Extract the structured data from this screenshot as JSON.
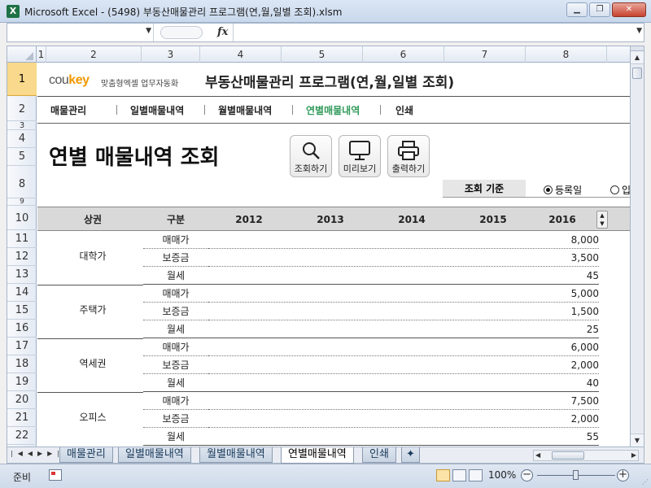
{
  "window": {
    "title": "Microsoft Excel - (5498) 부동산매물관리 프로그램(연,월,일별 조회).xlsm",
    "app_icon": "X",
    "minimize": "▁",
    "restore": "❐",
    "close": "✕"
  },
  "formula_bar": {
    "fx": "fx"
  },
  "columns": [
    "1",
    "2",
    "3",
    "4",
    "5",
    "6",
    "7",
    "8"
  ],
  "rows": [
    "1",
    "2",
    "3",
    "4",
    "5",
    "8",
    "9",
    "10",
    "11",
    "12",
    "13",
    "14",
    "15",
    "16",
    "17",
    "18",
    "19",
    "20",
    "21",
    "22"
  ],
  "header": {
    "logo_brand_prefix": "cou",
    "logo_brand_key": "key",
    "logo_sub": "맞춤형엑셀 업무자동화",
    "title": "부동산매물관리 프로그램(연,월,일별 조회)"
  },
  "nav": [
    "매물관리",
    "일별매물내역",
    "월별매물내역",
    "연별매물내역",
    "인쇄"
  ],
  "page": {
    "title": "연별 매물내역 조회",
    "buttons": {
      "search": "조회하기",
      "preview": "미리보기",
      "print": "출력하기"
    }
  },
  "criteria": {
    "label": "조회 기준",
    "option_selected": "등록일",
    "option_other": "입"
  },
  "table": {
    "headers": [
      "상권",
      "구분",
      "2012",
      "2013",
      "2014",
      "2015",
      "2016"
    ],
    "groups": [
      {
        "region": "대학가",
        "rows": [
          {
            "type": "매매가",
            "value": "8,000"
          },
          {
            "type": "보증금",
            "value": "3,500"
          },
          {
            "type": "월세",
            "value": "45"
          }
        ]
      },
      {
        "region": "주택가",
        "rows": [
          {
            "type": "매매가",
            "value": "5,000"
          },
          {
            "type": "보증금",
            "value": "1,500"
          },
          {
            "type": "월세",
            "value": "25"
          }
        ]
      },
      {
        "region": "역세권",
        "rows": [
          {
            "type": "매매가",
            "value": "6,000"
          },
          {
            "type": "보증금",
            "value": "2,000"
          },
          {
            "type": "월세",
            "value": "40"
          }
        ]
      },
      {
        "region": "오피스",
        "rows": [
          {
            "type": "매매가",
            "value": "7,500"
          },
          {
            "type": "보증금",
            "value": "2,000"
          },
          {
            "type": "월세",
            "value": "55"
          }
        ]
      }
    ]
  },
  "sheet_tabs": [
    "매물관리",
    "일별매물내역",
    "월별매물내역",
    "연별매물내역",
    "인쇄"
  ],
  "active_tab": "연별매물내역",
  "status": {
    "mode": "준비",
    "zoom": "100%",
    "zoom_minus": "−",
    "zoom_plus": "+"
  }
}
